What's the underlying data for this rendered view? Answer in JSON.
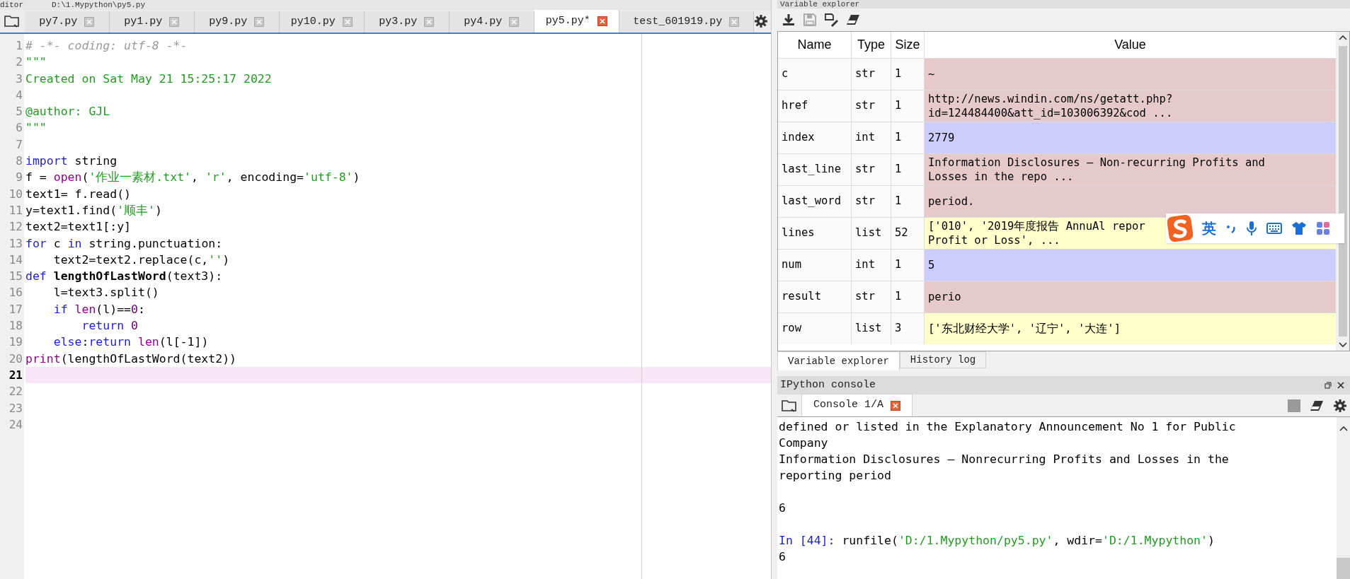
{
  "window_title": {
    "pane": "ditor",
    "path": "D:\\1.Mypython\\py5.py"
  },
  "editor": {
    "tabs": [
      {
        "label": "py7.py",
        "selected": false
      },
      {
        "label": "py1.py",
        "selected": false
      },
      {
        "label": "py9.py",
        "selected": false
      },
      {
        "label": "py10.py",
        "selected": false
      },
      {
        "label": "py3.py",
        "selected": false
      },
      {
        "label": "py4.py",
        "selected": false
      },
      {
        "label": "py5.py*",
        "selected": true
      },
      {
        "label": "test_601919.py",
        "selected": false
      }
    ],
    "lines": [
      {
        "number": "1",
        "current": false,
        "segments": [
          {
            "kind": "comment",
            "text": "# -*- coding: utf-8 -*-"
          }
        ]
      },
      {
        "number": "2",
        "current": false,
        "segments": [
          {
            "kind": "string",
            "text": "\"\"\""
          }
        ]
      },
      {
        "number": "3",
        "current": false,
        "segments": [
          {
            "kind": "string",
            "text": "Created on Sat May 21 15:25:17 2022"
          }
        ]
      },
      {
        "number": "4",
        "current": false
      },
      {
        "number": "5",
        "current": false,
        "segments": [
          {
            "kind": "string",
            "text": "@author: GJL"
          }
        ]
      },
      {
        "number": "6",
        "current": false,
        "segments": [
          {
            "kind": "string",
            "text": "\"\"\""
          }
        ]
      },
      {
        "number": "7",
        "current": false
      },
      {
        "number": "8",
        "current": false,
        "segments": [
          {
            "kind": "keyword",
            "text": "import"
          },
          {
            "kind": "plain",
            "text": " string"
          }
        ]
      },
      {
        "number": "9",
        "current": false,
        "segments": [
          {
            "kind": "plain",
            "text": "f = "
          },
          {
            "kind": "builtin",
            "text": "open"
          },
          {
            "kind": "plain",
            "text": "("
          },
          {
            "kind": "string",
            "text": "'作业一素材.txt'"
          },
          {
            "kind": "plain",
            "text": ", "
          },
          {
            "kind": "string",
            "text": "'r'"
          },
          {
            "kind": "plain",
            "text": ", encoding="
          },
          {
            "kind": "string",
            "text": "'utf-8'"
          },
          {
            "kind": "plain",
            "text": ")"
          }
        ]
      },
      {
        "number": "10",
        "current": false,
        "segments": [
          {
            "kind": "plain",
            "text": "text1= f.read()"
          }
        ]
      },
      {
        "number": "11",
        "current": false,
        "segments": [
          {
            "kind": "plain",
            "text": "y=text1.find("
          },
          {
            "kind": "string",
            "text": "'顺丰'"
          },
          {
            "kind": "plain",
            "text": ")"
          }
        ]
      },
      {
        "number": "12",
        "current": false,
        "segments": [
          {
            "kind": "plain",
            "text": "text2=text1[:y]"
          }
        ]
      },
      {
        "number": "13",
        "current": false,
        "segments": [
          {
            "kind": "keyword",
            "text": "for"
          },
          {
            "kind": "plain",
            "text": " c "
          },
          {
            "kind": "keyword",
            "text": "in"
          },
          {
            "kind": "plain",
            "text": " string.punctuation:"
          }
        ]
      },
      {
        "number": "14",
        "current": false,
        "segments": [
          {
            "kind": "plain",
            "text": "    text2=text2.replace(c,"
          },
          {
            "kind": "string",
            "text": "''"
          },
          {
            "kind": "plain",
            "text": ")"
          }
        ]
      },
      {
        "number": "15",
        "current": false,
        "segments": [
          {
            "kind": "keyword",
            "text": "def"
          },
          {
            "kind": "defname",
            "text": " lengthOfLastWord"
          },
          {
            "kind": "plain",
            "text": "(text3):"
          }
        ]
      },
      {
        "number": "16",
        "current": false,
        "segments": [
          {
            "kind": "plain",
            "text": "    l=text3.split()"
          }
        ]
      },
      {
        "number": "17",
        "current": false,
        "segments": [
          {
            "kind": "keyword",
            "text": "    if"
          },
          {
            "kind": "builtin",
            "text": " len"
          },
          {
            "kind": "plain",
            "text": "(l)=="
          },
          {
            "kind": "number",
            "text": "0"
          },
          {
            "kind": "plain",
            "text": ":"
          }
        ]
      },
      {
        "number": "18",
        "current": false,
        "segments": [
          {
            "kind": "keyword",
            "text": "        return"
          },
          {
            "kind": "number",
            "text": " 0"
          }
        ]
      },
      {
        "number": "19",
        "current": false,
        "segments": [
          {
            "kind": "keyword",
            "text": "    else"
          },
          {
            "kind": "plain",
            "text": ":"
          },
          {
            "kind": "keyword",
            "text": "return"
          },
          {
            "kind": "builtin",
            "text": " len"
          },
          {
            "kind": "plain",
            "text": "(l[-1])"
          }
        ]
      },
      {
        "number": "20",
        "current": false,
        "segments": [
          {
            "kind": "builtin",
            "text": "print"
          },
          {
            "kind": "plain",
            "text": "(lengthOfLastWord(text2))"
          }
        ]
      },
      {
        "number": "21",
        "current": true
      },
      {
        "number": "22",
        "current": false
      },
      {
        "number": "23",
        "current": false
      },
      {
        "number": "24",
        "current": false
      }
    ]
  },
  "variable_explorer": {
    "title": "Variable explorer",
    "columns": [
      "Name",
      "Type",
      "Size",
      "Value"
    ],
    "rows": [
      {
        "name": "c",
        "type": "str",
        "size": "1",
        "value": [
          "~"
        ],
        "color": "#e5c9cb"
      },
      {
        "name": "href",
        "type": "str",
        "size": "1",
        "value": [
          "http://news.windin.com/ns/getatt.php?",
          "id=124484400&att_id=103006392&cod ..."
        ],
        "color": "#e5c9cb"
      },
      {
        "name": "index",
        "type": "int",
        "size": "1",
        "value": [
          "2779"
        ],
        "color": "#ccccff"
      },
      {
        "name": "last_line",
        "type": "str",
        "size": "1",
        "value": [
          "Information Disclosures – Non-recurring Profits and",
          "Losses in the repo ..."
        ],
        "color": "#e5c9cb"
      },
      {
        "name": "last_word",
        "type": "str",
        "size": "1",
        "value": [
          "period."
        ],
        "color": "#e5c9cb"
      },
      {
        "name": "lines",
        "type": "list",
        "size": "52",
        "value": [
          "['010', '2019年度报告 AnnuAl repor",
          "Profit or Loss', ..."
        ],
        "color": "#ffffcc"
      },
      {
        "name": "num",
        "type": "int",
        "size": "1",
        "value": [
          "5"
        ],
        "color": "#ccccff"
      },
      {
        "name": "result",
        "type": "str",
        "size": "1",
        "value": [
          "perio"
        ],
        "color": "#e5c9cb"
      },
      {
        "name": "row",
        "type": "list",
        "size": "3",
        "value": [
          "['东北财经大学', '辽宁', '大连']"
        ],
        "color": "#ffffcc"
      }
    ],
    "tabs": [
      {
        "label": "Variable explorer",
        "selected": true
      },
      {
        "label": "History log",
        "selected": false
      }
    ]
  },
  "ime_toolbar": {
    "mode": "英"
  },
  "console": {
    "title": "IPython console",
    "tabs": [
      {
        "label": "Console 1/A",
        "selected": true
      }
    ],
    "lines": [
      {
        "segments": [
          {
            "kind": "plain",
            "text": "defined or listed in the Explanatory Announcement No 1 for Public"
          }
        ]
      },
      {
        "segments": [
          {
            "kind": "plain",
            "text": "Company"
          }
        ]
      },
      {
        "segments": [
          {
            "kind": "plain",
            "text": "Information Disclosures – Nonrecurring Profits and Losses in the"
          }
        ]
      },
      {
        "segments": [
          {
            "kind": "plain",
            "text": "reporting period"
          }
        ]
      },
      {
        "gap_before": true,
        "segments": [
          {
            "kind": "plain",
            "text": "6"
          }
        ]
      },
      {
        "gap_before": true,
        "segments": [
          {
            "kind": "prompt",
            "text": "In [44]: "
          },
          {
            "kind": "plain",
            "text": "runfile("
          },
          {
            "kind": "string",
            "text": "'D:/1.Mypython/py5.py'"
          },
          {
            "kind": "plain",
            "text": ", wdir="
          },
          {
            "kind": "string",
            "text": "'D:/1.Mypython'"
          },
          {
            "kind": "plain",
            "text": ")"
          }
        ]
      },
      {
        "segments": [
          {
            "kind": "plain",
            "text": "6"
          }
        ]
      }
    ]
  }
}
